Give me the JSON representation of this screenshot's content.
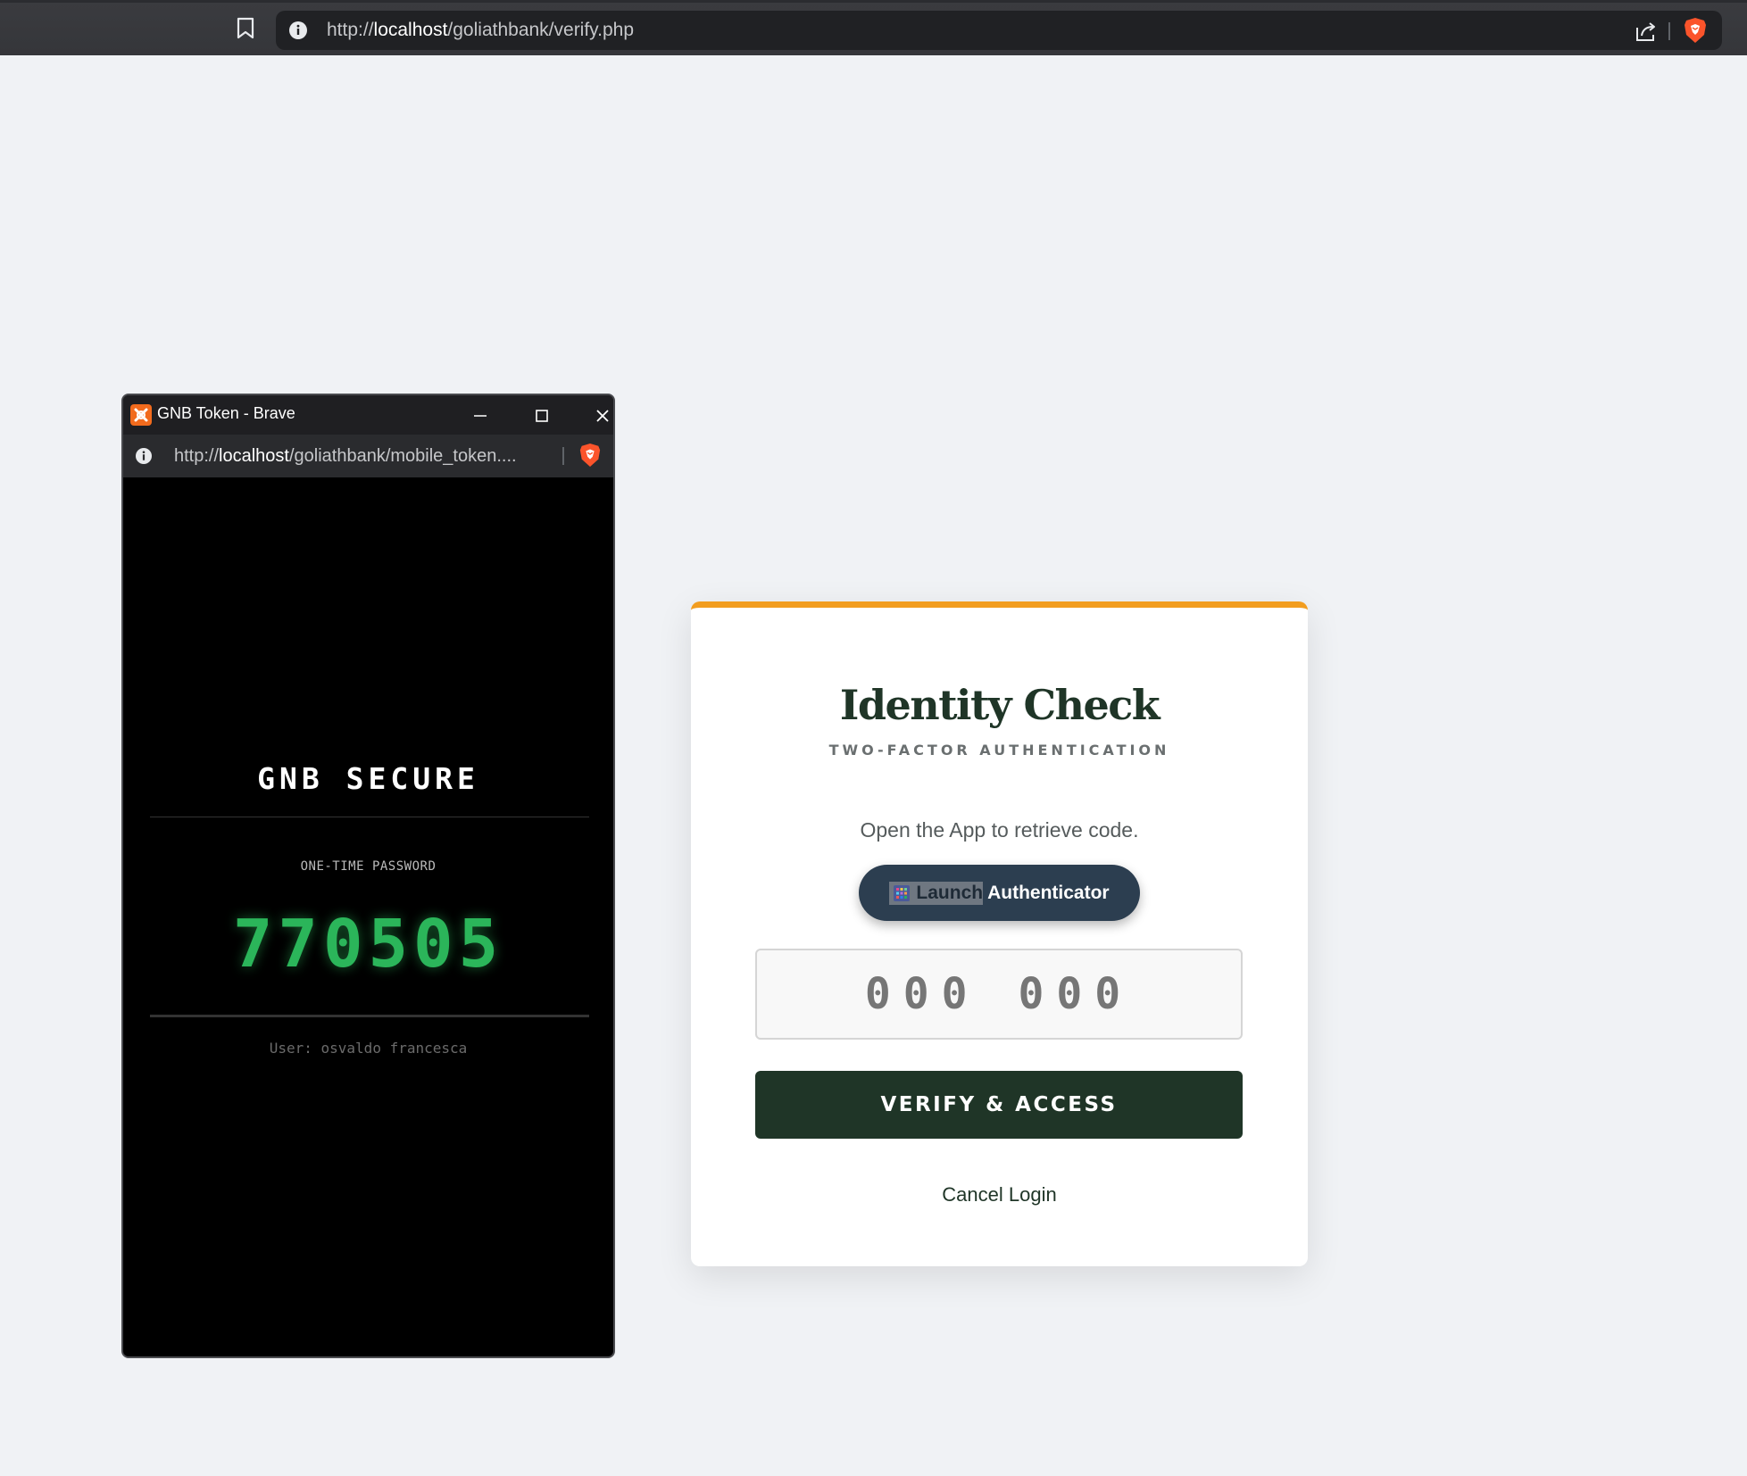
{
  "browser": {
    "url_prefix": "http://",
    "url_host": "localhost",
    "url_path": "/goliathbank/verify.php"
  },
  "popup": {
    "window_title": "GNB Token - Brave",
    "url_prefix": "http://",
    "url_host": "localhost",
    "url_path": "/goliathbank/mobile_token....",
    "token": {
      "brand": "GNB SECURE",
      "label": "ONE-TIME PASSWORD",
      "code": "770505",
      "user_line": "User: osvaldo francesca"
    }
  },
  "card": {
    "title": "Identity Check",
    "subtitle": "TWO-FACTOR AUTHENTICATION",
    "instruction": "Open the App to retrieve code.",
    "launch_button": {
      "selected_text": "Launch",
      "rest_text": "Authenticator"
    },
    "otp_input": {
      "value": "",
      "placeholder": "000 000"
    },
    "verify_label": "VERIFY & ACCESS",
    "cancel_label": "Cancel Login"
  },
  "colors": {
    "accent_top": "#f29d1f",
    "brand_dark_green": "#1f3527",
    "launch_button_bg": "#2c3e50",
    "otp_green": "#2bb55a",
    "page_bg": "#f0f2f5"
  }
}
